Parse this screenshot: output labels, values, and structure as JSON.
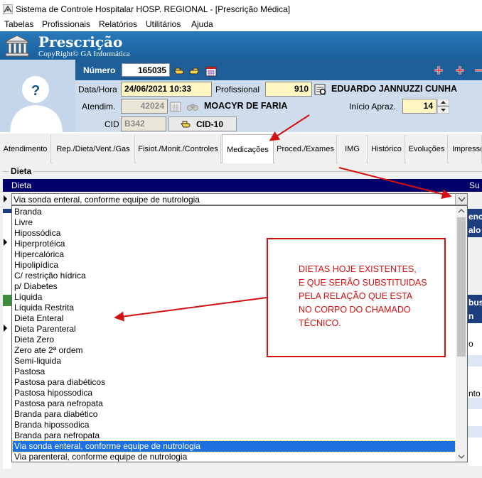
{
  "window": {
    "title": "Sistema de Controle Hospitalar HOSP. REGIONAL - [Prescrição Médica]"
  },
  "menu": [
    "Tabelas",
    "Profissionais",
    "Relatórios",
    "Utilitários",
    "Ajuda"
  ],
  "banner": {
    "title": "Prescrição",
    "subtitle": "CopyRight© GA Informática"
  },
  "header": {
    "numero_label": "Número",
    "numero_value": "165035",
    "datahora_label": "Data/Hora",
    "datahora_value": "24/06/2021 10:33",
    "profissional_label": "Profissional",
    "profissional_code": "910",
    "profissional_name": "EDUARDO JANNUZZI CUNHA",
    "atendim_label": "Atendim.",
    "atendim_value": "42024",
    "patient_name": "MOACYR DE FARIA",
    "inicio_label": "Início Apraz.",
    "inicio_value": "14",
    "cid_label": "CID",
    "cid_value": "B342",
    "cid_button": "CID-10"
  },
  "tabs": [
    "Atendimento",
    "Rep./Dieta/Vent./Gas",
    "Fisiot./Monit./Controles",
    "Medicações",
    "Proced./Exames",
    "IMG",
    "Histórico",
    "Evoluções",
    "Impresso"
  ],
  "active_tab": "Medicações",
  "dieta": {
    "group_title": "Dieta",
    "column_header": "Dieta",
    "column_header_right": "Su",
    "selected_value": "Via sonda enteral, conforme equipe de nutrologia",
    "options": [
      "Branda",
      "Livre",
      "Hipossódica",
      "Hiperprotéica",
      "Hipercalórica",
      "Hipolipídica",
      "C/ restrição hídrica",
      "p/ Diabetes",
      "Líquida",
      "Líquida Restrita",
      "Dieta Enteral",
      "Dieta Parenteral",
      "Dieta Zero",
      "Zero ate 2ª ordem",
      "Semi-liquida",
      "Pastosa",
      "Pastosa para diabéticos",
      "Pastosa hipossodica",
      "Pastosa para nefropata",
      "Branda para diabético",
      "Branda hipossodica",
      "Branda para nefropata",
      "Via sonda enteral, conforme equipe de nutrologia",
      "Via parenteral, conforme equipe de nutrologia"
    ],
    "behind_right": [
      "enc",
      "alo",
      "bus",
      "n",
      "o",
      "nto"
    ]
  },
  "annotation": {
    "text": "DIETAS HOJE EXISTENTES,\nE QUE SERÃO SUBSTITUIDAS\nPELA RELAÇÃO QUE ESTA\nNO CORPO DO CHAMADO\nTÉCNICO."
  },
  "colors": {
    "banner": "#1f6aa8",
    "grid_header": "#02006a",
    "selection": "#1e70e0",
    "annotation": "#d41010"
  }
}
